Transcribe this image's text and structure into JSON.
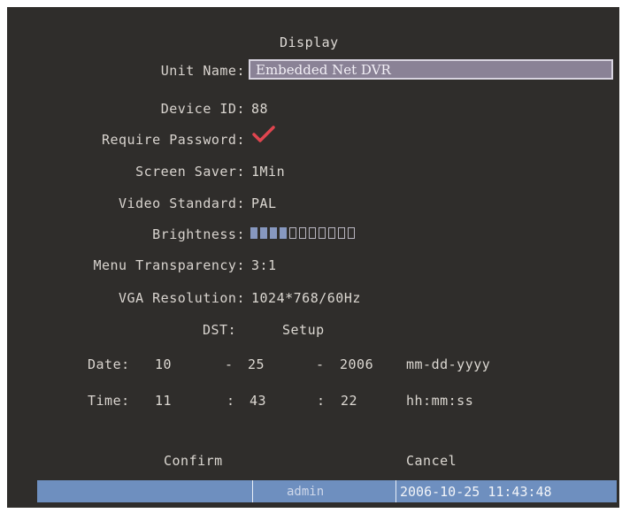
{
  "title": "Display",
  "fields": {
    "unit_name": {
      "label": "Unit Name:",
      "value": "Embedded Net DVR"
    },
    "device_id": {
      "label": "Device ID:",
      "value": "88"
    },
    "require_password": {
      "label": "Require Password:",
      "checked": true
    },
    "screen_saver": {
      "label": "Screen Saver:",
      "value": "1Min"
    },
    "video_standard": {
      "label": "Video Standard:",
      "value": "PAL"
    },
    "brightness": {
      "label": "Brightness:",
      "level": 4,
      "max": 11
    },
    "menu_transparency": {
      "label": "Menu Transparency:",
      "value": "3:1"
    },
    "vga_resolution": {
      "label": "VGA Resolution:",
      "value": "1024*768/60Hz"
    },
    "dst": {
      "label": "DST:",
      "setup_label": "Setup"
    }
  },
  "date": {
    "label": "Date:",
    "month": "10",
    "sep1": "-",
    "day": "25",
    "sep2": "-",
    "year": "2006",
    "format": "mm-dd-yyyy"
  },
  "time": {
    "label": "Time:",
    "hour": "11",
    "sep1": ":",
    "minute": "43",
    "sep2": ":",
    "second": "22",
    "format": "hh:mm:ss"
  },
  "buttons": {
    "confirm": "Confirm",
    "cancel": "Cancel"
  },
  "status": {
    "user": "admin",
    "datetime": "2006-10-25 11:43:48"
  },
  "colors": {
    "screen_bg": "#2f2d2b",
    "status_bar": "#6e8fbf",
    "check": "#e0454f",
    "brightness_on": "#8798c0"
  }
}
